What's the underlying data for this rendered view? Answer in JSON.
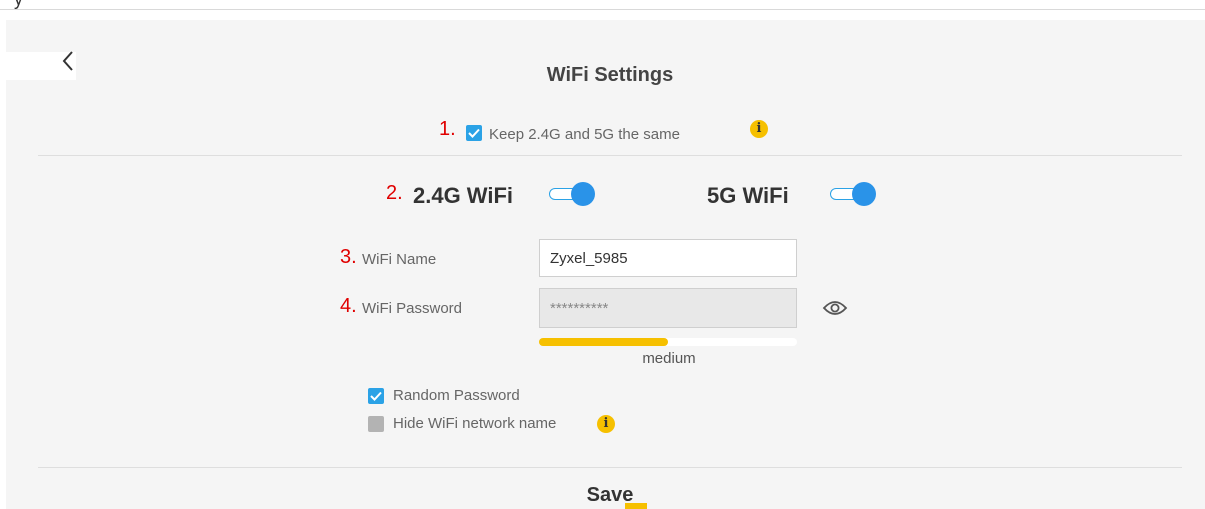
{
  "header": {
    "fragment": "y"
  },
  "page": {
    "title": "WiFi Settings",
    "back_icon": "chevron-left-icon"
  },
  "sync": {
    "step": "1.",
    "label": "Keep 2.4G and 5G the same",
    "checked": true,
    "info_icon": "i"
  },
  "bands": {
    "step": "2.",
    "band_24": {
      "label": "2.4G WiFi",
      "enabled": true
    },
    "band_5": {
      "label": "5G WiFi",
      "enabled": true
    }
  },
  "wifi_name": {
    "step": "3.",
    "label": "WiFi Name",
    "value": "Zyxel_5985"
  },
  "wifi_password": {
    "step": "4.",
    "label": "WiFi Password",
    "value": "**********",
    "eye_icon": "eye-icon"
  },
  "strength": {
    "level": 0.5,
    "text": "medium"
  },
  "options": {
    "random_password": {
      "label": "Random Password",
      "checked": true
    },
    "hide_network": {
      "label": "Hide WiFi network name",
      "checked": false,
      "info_icon": "i"
    }
  },
  "actions": {
    "save_label": "Save"
  },
  "colors": {
    "accent": "#2ba2e6",
    "toggle_knob": "#2a93e8",
    "warning": "#f6c000",
    "step_number": "#e00000",
    "panel_bg": "#f5f5f5"
  }
}
